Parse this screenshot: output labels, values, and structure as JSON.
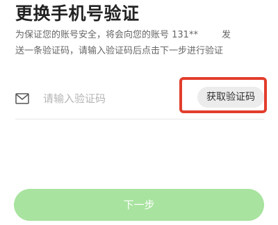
{
  "page": {
    "title": "更换手机号验证",
    "description_line1_prefix": "为保证您的账号安全，将会向您的账号 131**",
    "description_line1_suffix": "发",
    "description_line2": "送一条验证码，请输入验证码后点击下一步进行验证"
  },
  "code_field": {
    "icon": "mail-icon",
    "placeholder": "请输入验证码",
    "value": "",
    "get_code_label": "获取验证码"
  },
  "next_button": {
    "label": "下一步",
    "enabled": false
  },
  "colors": {
    "next_button_disabled": "#a8e39f",
    "highlight": "#e23d2c",
    "get_code_background": "#ececec"
  }
}
